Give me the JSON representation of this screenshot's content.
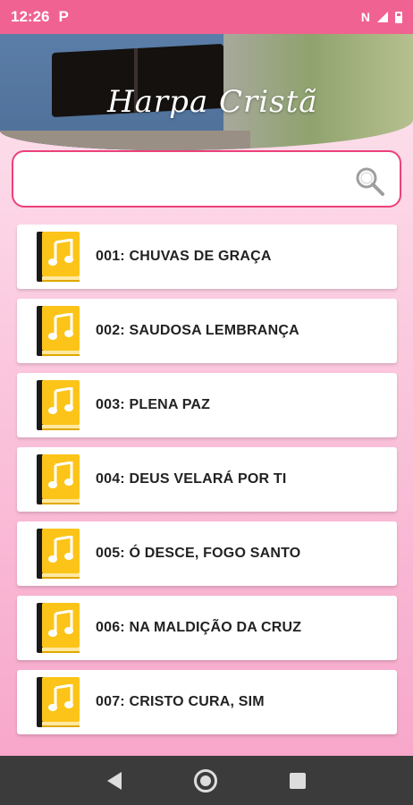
{
  "status_bar": {
    "time": "12:26",
    "notification_icon": "P",
    "nfc_label": "N",
    "icons": [
      "nfc-icon",
      "signal-icon",
      "battery-icon"
    ]
  },
  "header": {
    "title": "Harpa Cristã"
  },
  "search": {
    "value": "",
    "placeholder": "",
    "icon": "search-icon"
  },
  "hymns": [
    {
      "label": "001: CHUVAS DE GRAÇA"
    },
    {
      "label": "002: SAUDOSA LEMBRANÇA"
    },
    {
      "label": "003: PLENA PAZ"
    },
    {
      "label": "004: DEUS VELARÁ POR TI"
    },
    {
      "label": "005: Ó DESCE, FOGO SANTO"
    },
    {
      "label": "006: NA MALDIÇÃO DA CRUZ"
    },
    {
      "label": "007: CRISTO CURA, SIM"
    }
  ],
  "colors": {
    "accent": "#ec407a",
    "status_bar": "#f06292",
    "icon_yellow": "#fcc419",
    "nav_bar": "#3b3b3b"
  },
  "navigation": [
    "back-icon",
    "home-icon",
    "recents-icon"
  ]
}
